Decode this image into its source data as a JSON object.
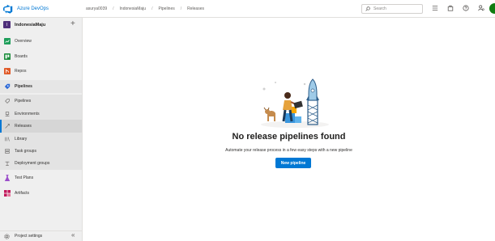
{
  "app": {
    "name": "Azure DevOps",
    "brand_color": "#0078d4"
  },
  "breadcrumb": [
    "asurya0039",
    "IndonesiaMaju",
    "Pipelines",
    "Releases"
  ],
  "search": {
    "placeholder": "Search"
  },
  "user": {
    "initial": ""
  },
  "project": {
    "badge": "I",
    "name": "IndonesiaMaju",
    "add_icon": "+"
  },
  "nav": {
    "overview": "Overview",
    "boards": "Boards",
    "repos": "Repos",
    "pipelines": "Pipelines",
    "pipelines_sub": "Pipelines",
    "environments": "Environments",
    "releases": "Releases",
    "library": "Library",
    "task_groups": "Task groups",
    "deployment_groups": "Deployment groups",
    "test_plans": "Test Plans",
    "artifacts": "Artifacts"
  },
  "footer": {
    "settings": "Project settings",
    "collapse_icon": "«"
  },
  "empty_state": {
    "title": "No release pipelines found",
    "subtitle": "Automate your release process in a few easy steps with a new pipeline",
    "button": "New pipeline"
  },
  "colors": {
    "active_accent": "#0078d4",
    "sidebar_bg": "#efefef",
    "button_bg": "#0078d4",
    "avatar_bg": "#107c10"
  }
}
